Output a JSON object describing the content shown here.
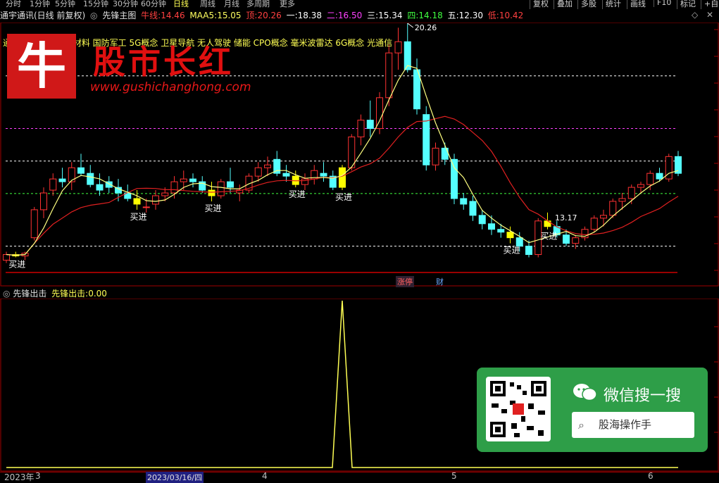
{
  "toolbar": {
    "periods": [
      "分时",
      "1分钟",
      "5分钟",
      "15分钟",
      "30分钟",
      "60分钟",
      "日线",
      "周线",
      "月线",
      "多周期",
      "更多"
    ],
    "active_period": "日线",
    "right_buttons": [
      "复权",
      "叠加",
      "多股",
      "统计",
      "画线",
      "F10",
      "标记",
      "+自选"
    ]
  },
  "info": {
    "stock": "通宇通讯(日线 前复权)",
    "indicator_name": "先锋主图",
    "niuxian_label": "牛线:",
    "niuxian_value": "14.46",
    "maa5_label": "MAA5:",
    "maa5_value": "15.05",
    "ding_label": "顶:",
    "ding_value": "20.26",
    "l1_label": "一:",
    "l1_value": "18.38",
    "l2_label": "二:",
    "l2_value": "16.50",
    "l3_label": "三:",
    "l3_value": "15.34",
    "l4_label": "四:",
    "l4_value": "14.18",
    "l5_label": "五:",
    "l5_value": "12.30",
    "di_label": "低:",
    "di_value": "10.42"
  },
  "concepts": "通信设备 东板块新材料 国防军工 5G概念 卫星导航 无人驾驶 储能 CPO概念 毫米波雷达 6G概念 光通信",
  "watermark": {
    "logo_char": "牛",
    "title": "股市长红",
    "url": "www.gushichanghong.com"
  },
  "annotations": {
    "high_label": "20.26",
    "low_label": "13.17",
    "buy_label": "买进"
  },
  "tabs_mid": [
    "涨停",
    "财"
  ],
  "sub": {
    "title": "先锋出击",
    "value_label": "先锋出击:",
    "value": "0.00"
  },
  "ad": {
    "title": "微信搜一搜",
    "search_text": "股海操作手"
  },
  "axis": {
    "labels": [
      "2023年",
      "3",
      "2023/03/16/四",
      "4",
      "5",
      "6"
    ]
  },
  "colors": {
    "up": "#ff3232",
    "down": "#54ffff",
    "buy": "#ffff00",
    "ma_slow": "#e02020",
    "ma_fast": "#ffff80"
  },
  "candles": [
    [
      11.8,
      12.1,
      11.7,
      12.0
    ],
    [
      12.0,
      12.1,
      11.9,
      11.95
    ],
    [
      11.95,
      12.1,
      11.8,
      12.05
    ],
    [
      12.6,
      13.7,
      12.5,
      13.6
    ],
    [
      13.6,
      14.4,
      13.3,
      14.2
    ],
    [
      14.3,
      14.9,
      14.1,
      14.7
    ],
    [
      14.7,
      15.1,
      14.4,
      14.6
    ],
    [
      14.6,
      15.3,
      14.3,
      15.1
    ],
    [
      15.1,
      15.6,
      14.8,
      14.9
    ],
    [
      14.9,
      15.2,
      14.4,
      14.5
    ],
    [
      14.5,
      14.9,
      14.1,
      14.3
    ],
    [
      14.6,
      14.8,
      14.2,
      14.4
    ],
    [
      14.4,
      14.7,
      13.9,
      14.2
    ],
    [
      14.2,
      14.5,
      13.9,
      14.0
    ],
    [
      14.0,
      14.3,
      13.6,
      13.8
    ],
    [
      13.7,
      14.0,
      13.5,
      13.7
    ],
    [
      13.8,
      14.3,
      13.6,
      14.1
    ],
    [
      14.1,
      14.4,
      13.9,
      14.2
    ],
    [
      14.2,
      14.8,
      14.0,
      14.6
    ],
    [
      14.6,
      15.0,
      14.3,
      14.7
    ],
    [
      14.7,
      14.9,
      14.4,
      14.6
    ],
    [
      14.6,
      14.8,
      14.2,
      14.3
    ],
    [
      14.3,
      14.6,
      13.9,
      14.1
    ],
    [
      14.1,
      14.7,
      14.0,
      14.6
    ],
    [
      14.6,
      15.1,
      14.2,
      14.4
    ],
    [
      14.2,
      14.5,
      13.9,
      14.3
    ],
    [
      14.3,
      14.9,
      14.2,
      14.8
    ],
    [
      14.8,
      15.3,
      14.6,
      15.1
    ],
    [
      15.1,
      15.5,
      14.8,
      15.2
    ],
    [
      15.4,
      15.7,
      14.8,
      14.9
    ],
    [
      14.9,
      15.2,
      14.6,
      14.8
    ],
    [
      14.8,
      15.0,
      14.4,
      14.5
    ],
    [
      14.5,
      14.9,
      14.3,
      14.7
    ],
    [
      14.7,
      15.2,
      14.5,
      15.0
    ],
    [
      14.9,
      15.3,
      14.6,
      14.8
    ],
    [
      14.8,
      15.0,
      14.3,
      14.4
    ],
    [
      14.4,
      15.2,
      14.3,
      15.1
    ],
    [
      15.1,
      16.3,
      15.0,
      16.2
    ],
    [
      16.2,
      17.0,
      15.9,
      16.8
    ],
    [
      16.8,
      17.5,
      16.2,
      16.5
    ],
    [
      16.5,
      17.8,
      16.3,
      17.6
    ],
    [
      17.6,
      19.5,
      17.3,
      19.2
    ],
    [
      19.2,
      20.1,
      18.6,
      19.6
    ],
    [
      19.6,
      20.26,
      18.5,
      18.6
    ],
    [
      18.6,
      19.0,
      17.0,
      17.2
    ],
    [
      17.0,
      17.3,
      15.0,
      15.2
    ],
    [
      15.2,
      16.0,
      15.0,
      15.8
    ],
    [
      15.8,
      16.0,
      15.2,
      15.4
    ],
    [
      15.4,
      15.6,
      13.8,
      14.0
    ],
    [
      14.0,
      14.2,
      13.6,
      13.8
    ],
    [
      13.9,
      14.1,
      13.2,
      13.4
    ],
    [
      13.4,
      13.6,
      12.9,
      13.1
    ],
    [
      13.1,
      13.4,
      12.7,
      12.9
    ],
    [
      12.9,
      13.1,
      12.6,
      12.8
    ],
    [
      12.8,
      13.0,
      12.4,
      12.6
    ],
    [
      12.6,
      12.8,
      12.1,
      12.3
    ],
    [
      12.3,
      12.5,
      11.9,
      12.0
    ],
    [
      12.0,
      13.3,
      11.9,
      13.2
    ],
    [
      13.2,
      13.5,
      12.9,
      13.0
    ],
    [
      13.0,
      13.2,
      12.6,
      12.7
    ],
    [
      12.7,
      12.9,
      12.3,
      12.4
    ],
    [
      12.4,
      12.7,
      12.2,
      12.6
    ],
    [
      12.6,
      13.0,
      12.5,
      12.9
    ],
    [
      12.9,
      13.4,
      12.8,
      13.3
    ],
    [
      13.3,
      13.6,
      13.0,
      13.4
    ],
    [
      13.4,
      14.0,
      13.3,
      13.9
    ],
    [
      13.9,
      14.2,
      13.6,
      14.0
    ],
    [
      14.0,
      14.5,
      13.8,
      14.4
    ],
    [
      14.4,
      14.6,
      14.2,
      14.5
    ],
    [
      14.5,
      15.0,
      14.3,
      14.9
    ],
    [
      14.9,
      15.1,
      14.6,
      14.7
    ],
    [
      14.7,
      15.6,
      14.6,
      15.5
    ],
    [
      15.5,
      15.7,
      14.8,
      14.9
    ]
  ],
  "buy_indices": [
    1,
    14,
    22,
    31,
    36,
    54,
    58
  ],
  "spike_index": 36
}
